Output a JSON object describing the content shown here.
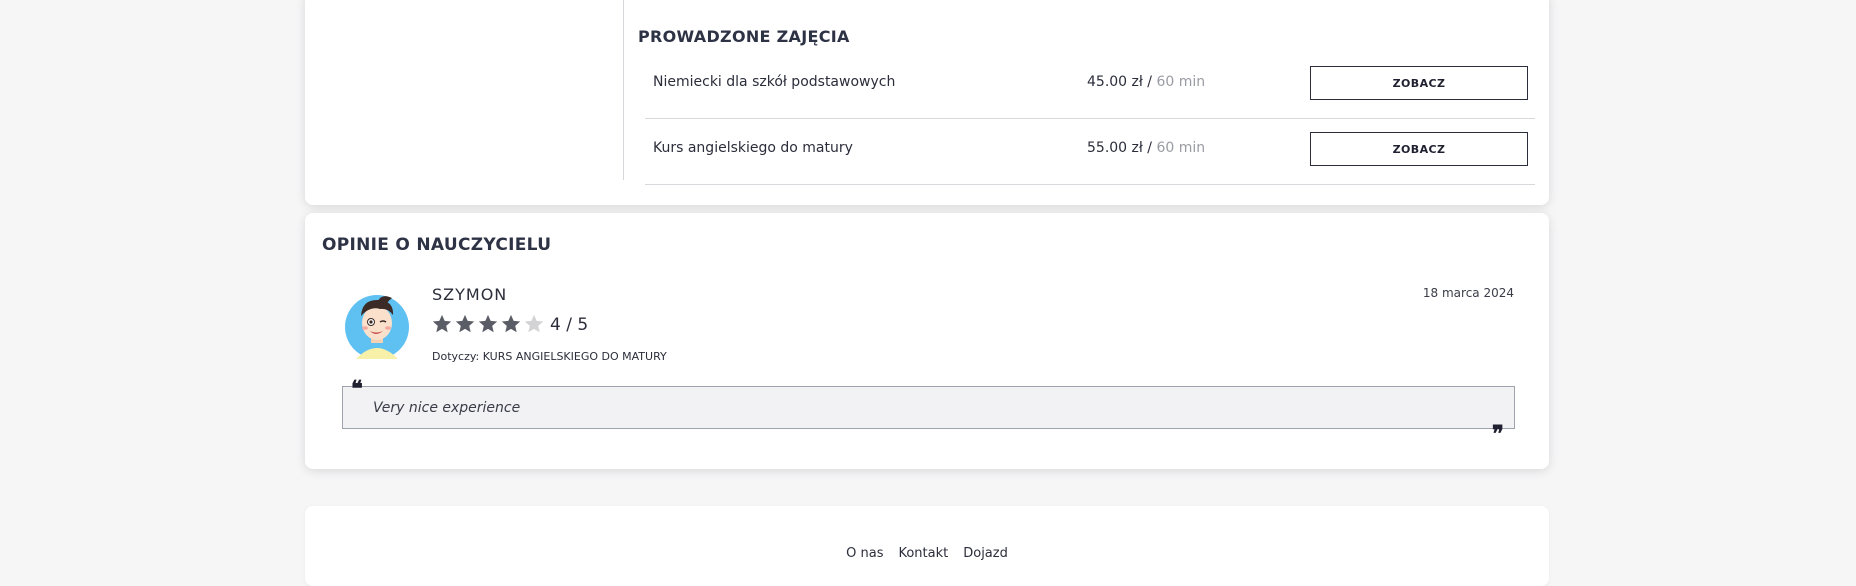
{
  "courses": {
    "title": "PROWADZONE ZAJĘCIA",
    "items": [
      {
        "name": "Niemiecki dla szkół podstawowych",
        "price": "45.00 zł / ",
        "duration": "60 min",
        "button": "ZOBACZ"
      },
      {
        "name": "Kurs angielskiego do matury",
        "price": "55.00 zł / ",
        "duration": "60 min",
        "button": "ZOBACZ"
      }
    ]
  },
  "reviews": {
    "title": "OPINIE O NAUCZYCIELU",
    "items": [
      {
        "name": "SZYMON",
        "date": "18 marca 2024",
        "rating": 4,
        "rating_max": 5,
        "rating_text": "4 / 5",
        "concerns": "Dotyczy: KURS ANGIELSKIEGO DO MATURY",
        "text": "Very nice experience",
        "avatar_icon": "cartoon-boy-avatar"
      }
    ]
  },
  "footer": {
    "links": [
      "O nas",
      "Kontakt",
      "Dojazd"
    ]
  },
  "colors": {
    "star_filled": "#5a5c66",
    "star_empty": "#d3d3d6",
    "avatar_bg": "#5fc0f2"
  }
}
